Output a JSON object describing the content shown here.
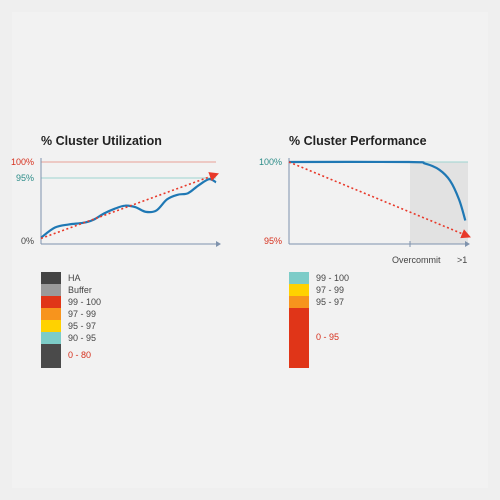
{
  "colors": {
    "axis": "#7f93ad",
    "line": "#1f78b4",
    "trend": "#e8392a",
    "ref_red": "#e8a097",
    "ref_teal": "#9dd4d0",
    "shade": "#e2e2e2",
    "red_text": "#d6301d",
    "teal_text": "#2b8c88"
  },
  "chart_data": [
    {
      "type": "line",
      "title": "% Cluster Utilization",
      "y_ticks": [
        "100%",
        "95%",
        "0%"
      ],
      "y_tick_values": [
        100,
        95,
        0
      ],
      "ylim": [
        0,
        100
      ],
      "xlim": [
        0,
        10
      ],
      "series": [
        {
          "values": [
            [
              0,
              3
            ],
            [
              0.8,
              16
            ],
            [
              1.6,
              20
            ],
            [
              2.4,
              22
            ],
            [
              3,
              26
            ],
            [
              3.6,
              34
            ],
            [
              4.2,
              40
            ],
            [
              4.8,
              44
            ],
            [
              5.4,
              42
            ],
            [
              6,
              36
            ],
            [
              6.6,
              38
            ],
            [
              7.2,
              52
            ],
            [
              7.8,
              58
            ],
            [
              8.4,
              60
            ],
            [
              9,
              70
            ],
            [
              9.6,
              78
            ],
            [
              10,
              74
            ]
          ]
        }
      ],
      "trend": {
        "from": [
          0,
          2
        ],
        "to": [
          10,
          84
        ]
      },
      "reference_lines": [
        100,
        95
      ],
      "legend": [
        {
          "label": "HA",
          "color": "#444444"
        },
        {
          "label": "Buffer",
          "color": "#9a9a9a"
        },
        {
          "label": "99 - 100",
          "color": "#e03518"
        },
        {
          "label": "97 - 99",
          "color": "#f7941d"
        },
        {
          "label": "95 - 97",
          "color": "#ffd200"
        },
        {
          "label": "90 - 95",
          "color": "#7dccc8"
        },
        {
          "label": "0 - 80",
          "color": "#4a4a4a",
          "text_color": "#d6301d"
        }
      ]
    },
    {
      "type": "line",
      "title": "% Cluster Performance",
      "y_ticks": [
        "100%",
        "95%"
      ],
      "x_ticks": [
        "Overcommit",
        ">1"
      ],
      "ylim": [
        0,
        100
      ],
      "xlim": [
        0,
        10
      ],
      "series": [
        {
          "values": [
            [
              0,
              100
            ],
            [
              6.7,
              100
            ],
            [
              7.6,
              98
            ],
            [
              8.4,
              90
            ],
            [
              9.0,
              76
            ],
            [
              9.5,
              52
            ],
            [
              9.85,
              25
            ]
          ]
        }
      ],
      "trend": {
        "from": [
          0,
          100
        ],
        "to": [
          10,
          5
        ]
      },
      "reference_lines": [
        100
      ],
      "shaded_region": [
        6.8,
        10
      ],
      "legend": [
        {
          "label": "99 - 100",
          "color": "#7dccc8"
        },
        {
          "label": "97 - 99",
          "color": "#ffd200"
        },
        {
          "label": "95 - 97",
          "color": "#f7941d"
        },
        {
          "label": "0 - 95",
          "color": "#e03518",
          "text_color": "#d6301d"
        }
      ]
    }
  ]
}
